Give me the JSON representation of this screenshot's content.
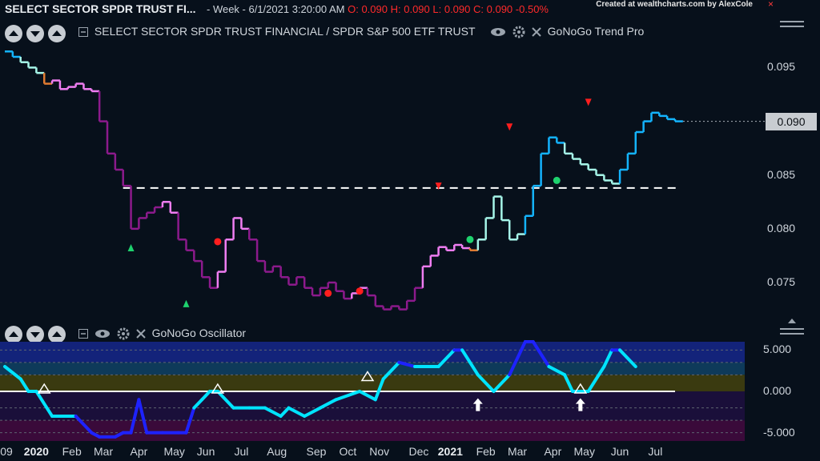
{
  "header": {
    "title": "SELECT SECTOR SPDR TRUST FI...",
    "meta_prefix": "- Week - 6/1/2021 3:20:00 AM",
    "open": "O: 0.090",
    "high": "H: 0.090",
    "low": "L: 0.090",
    "close": "C: 0.090",
    "change": "-0.50%",
    "credit": "Created at wealthcharts.com by AlexCole",
    "credit_x": "×"
  },
  "price_panel": {
    "legend": "SELECT SECTOR SPDR TRUST FINANCIAL / SPDR S&P 500 ETF TRUST",
    "indicator": "GoNoGo Trend Pro",
    "current_label": "0.090"
  },
  "osc_panel": {
    "indicator": "GoNoGo Oscillator"
  },
  "icons": {
    "up": "chevron-up-icon",
    "down": "chevron-down-icon",
    "eye": "eye-icon",
    "gear": "gear-icon",
    "close": "close-icon",
    "collapse": "minus-box-icon"
  },
  "colors": {
    "background": "#07101b",
    "go_strong": "#14b4ff",
    "go_weak": "#a6f6e9",
    "nogo_strong": "#8c1a8c",
    "nogo_weak": "#f07ef2",
    "amber": "#e07b31",
    "osc_high": "#00e4ff",
    "osc_low": "#1e22ff",
    "signal_red": "#ff1e1e",
    "signal_green": "#1ed26e"
  },
  "chart_data": [
    {
      "type": "line",
      "title": "SELECT SECTOR SPDR TRUST FINANCIAL / SPDR S&P 500 ETF TRUST",
      "ylim": [
        0.0715,
        0.0995
      ],
      "yticks": [
        0.075,
        0.08,
        0.085,
        0.09,
        0.095
      ],
      "ytick_labels": [
        "0.075",
        "0.080",
        "0.085",
        "0.090",
        "0.095"
      ],
      "support_level": 0.0838,
      "current_value": 0.09,
      "series": [
        {
          "values": [
            [
              0,
              0.0965,
              "go_strong"
            ],
            [
              1,
              0.096,
              "go_strong"
            ],
            [
              2,
              0.0955,
              "go_weak"
            ],
            [
              3,
              0.095,
              "go_weak"
            ],
            [
              4,
              0.0945,
              "go_weak"
            ],
            [
              5,
              0.0935,
              "amber"
            ],
            [
              6,
              0.0938,
              "nogo_weak"
            ],
            [
              7,
              0.093,
              "nogo_weak"
            ],
            [
              8,
              0.0932,
              "nogo_weak"
            ],
            [
              9,
              0.0935,
              "nogo_weak"
            ],
            [
              10,
              0.093,
              "nogo_weak"
            ],
            [
              11,
              0.0928,
              "nogo_weak"
            ],
            [
              12,
              0.09,
              "nogo_strong"
            ],
            [
              13,
              0.087,
              "nogo_strong"
            ],
            [
              14,
              0.0855,
              "nogo_strong"
            ],
            [
              15,
              0.084,
              "nogo_strong"
            ],
            [
              16,
              0.08,
              "nogo_strong"
            ],
            [
              17,
              0.081,
              "nogo_strong"
            ],
            [
              18,
              0.0815,
              "nogo_strong"
            ],
            [
              19,
              0.082,
              "nogo_strong"
            ],
            [
              20,
              0.0825,
              "nogo_weak"
            ],
            [
              21,
              0.0815,
              "nogo_weak"
            ],
            [
              22,
              0.079,
              "nogo_strong"
            ],
            [
              23,
              0.078,
              "nogo_strong"
            ],
            [
              24,
              0.077,
              "nogo_strong"
            ],
            [
              25,
              0.0755,
              "nogo_strong"
            ],
            [
              26,
              0.0745,
              "nogo_strong"
            ],
            [
              27,
              0.076,
              "nogo_weak"
            ],
            [
              28,
              0.079,
              "nogo_weak"
            ],
            [
              29,
              0.081,
              "nogo_weak"
            ],
            [
              30,
              0.08,
              "nogo_weak"
            ],
            [
              31,
              0.079,
              "nogo_strong"
            ],
            [
              32,
              0.077,
              "nogo_strong"
            ],
            [
              33,
              0.076,
              "nogo_strong"
            ],
            [
              34,
              0.0765,
              "nogo_strong"
            ],
            [
              35,
              0.0755,
              "nogo_strong"
            ],
            [
              36,
              0.0748,
              "nogo_strong"
            ],
            [
              37,
              0.0755,
              "nogo_strong"
            ],
            [
              38,
              0.0745,
              "nogo_strong"
            ],
            [
              39,
              0.0738,
              "nogo_strong"
            ],
            [
              40,
              0.0745,
              "nogo_strong"
            ],
            [
              41,
              0.075,
              "nogo_strong"
            ],
            [
              42,
              0.0742,
              "nogo_strong"
            ],
            [
              43,
              0.0735,
              "nogo_strong"
            ],
            [
              44,
              0.074,
              "nogo_weak"
            ],
            [
              45,
              0.0745,
              "nogo_weak"
            ],
            [
              46,
              0.0738,
              "nogo_strong"
            ],
            [
              47,
              0.0728,
              "nogo_strong"
            ],
            [
              48,
              0.0725,
              "nogo_strong"
            ],
            [
              49,
              0.0728,
              "nogo_strong"
            ],
            [
              50,
              0.0725,
              "nogo_strong"
            ],
            [
              51,
              0.0733,
              "nogo_strong"
            ],
            [
              52,
              0.0745,
              "nogo_strong"
            ],
            [
              53,
              0.0765,
              "nogo_weak"
            ],
            [
              54,
              0.0775,
              "nogo_weak"
            ],
            [
              55,
              0.0783,
              "nogo_weak"
            ],
            [
              56,
              0.078,
              "nogo_weak"
            ],
            [
              57,
              0.0785,
              "nogo_weak"
            ],
            [
              58,
              0.0782,
              "nogo_weak"
            ],
            [
              59,
              0.078,
              "amber"
            ],
            [
              60,
              0.079,
              "go_weak"
            ],
            [
              61,
              0.081,
              "go_weak"
            ],
            [
              62,
              0.083,
              "go_weak"
            ],
            [
              63,
              0.0808,
              "go_weak"
            ],
            [
              64,
              0.079,
              "go_weak"
            ],
            [
              65,
              0.0795,
              "go_weak"
            ],
            [
              66,
              0.0812,
              "go_strong"
            ],
            [
              67,
              0.084,
              "go_strong"
            ],
            [
              68,
              0.087,
              "go_strong"
            ],
            [
              69,
              0.0885,
              "go_strong"
            ],
            [
              70,
              0.088,
              "go_strong"
            ],
            [
              71,
              0.087,
              "go_weak"
            ],
            [
              72,
              0.0865,
              "go_weak"
            ],
            [
              73,
              0.086,
              "go_weak"
            ],
            [
              74,
              0.0855,
              "go_weak"
            ],
            [
              75,
              0.085,
              "go_weak"
            ],
            [
              76,
              0.0845,
              "go_weak"
            ],
            [
              77,
              0.0842,
              "go_weak"
            ],
            [
              78,
              0.0855,
              "go_strong"
            ],
            [
              79,
              0.087,
              "go_strong"
            ],
            [
              80,
              0.089,
              "go_strong"
            ],
            [
              81,
              0.09,
              "go_strong"
            ],
            [
              82,
              0.0908,
              "go_strong"
            ],
            [
              83,
              0.0905,
              "go_strong"
            ],
            [
              84,
              0.0902,
              "go_strong"
            ],
            [
              85,
              0.09,
              "go_strong"
            ]
          ]
        }
      ],
      "markers": [
        {
          "type": "up_triangle",
          "color": "signal_green",
          "x": 16,
          "y": 0.0782
        },
        {
          "type": "up_triangle",
          "color": "signal_green",
          "x": 23,
          "y": 0.073
        },
        {
          "type": "dot",
          "color": "signal_red",
          "x": 27,
          "y": 0.0788
        },
        {
          "type": "dot",
          "color": "signal_red",
          "x": 41,
          "y": 0.074
        },
        {
          "type": "dot",
          "color": "signal_red",
          "x": 45,
          "y": 0.0742
        },
        {
          "type": "down_triangle",
          "color": "signal_red",
          "x": 55,
          "y": 0.084
        },
        {
          "type": "dot",
          "color": "signal_green",
          "x": 59,
          "y": 0.079
        },
        {
          "type": "down_triangle",
          "color": "signal_red",
          "x": 64,
          "y": 0.0895
        },
        {
          "type": "dot",
          "color": "signal_green",
          "x": 70,
          "y": 0.0845
        },
        {
          "type": "down_triangle",
          "color": "signal_red",
          "x": 74,
          "y": 0.0918
        }
      ]
    },
    {
      "type": "line",
      "title": "GoNoGo Oscillator",
      "ylim": [
        -6,
        6
      ],
      "yticks": [
        -5,
        0,
        5
      ],
      "ytick_labels": [
        "-5.000",
        "0.000",
        "5.000"
      ],
      "x_extent": [
        0,
        85
      ],
      "series": [
        {
          "values": [
            [
              0,
              3
            ],
            [
              2,
              1.5
            ],
            [
              3,
              0
            ],
            [
              4,
              0
            ],
            [
              6,
              -3
            ],
            [
              9,
              -3
            ],
            [
              11,
              -5
            ],
            [
              12,
              -5.5
            ],
            [
              14,
              -5.5
            ],
            [
              15,
              -5
            ],
            [
              16,
              -5
            ],
            [
              17,
              -1
            ],
            [
              18,
              -5
            ],
            [
              20,
              -5
            ],
            [
              22,
              -5
            ],
            [
              23,
              -5
            ],
            [
              24,
              -2
            ],
            [
              25,
              -1
            ],
            [
              26,
              0
            ],
            [
              27,
              0
            ],
            [
              29,
              -2
            ],
            [
              31,
              -2
            ],
            [
              33,
              -2
            ],
            [
              35,
              -3
            ],
            [
              36,
              -2
            ],
            [
              38,
              -3
            ],
            [
              40,
              -2
            ],
            [
              42,
              -1
            ],
            [
              45,
              0
            ],
            [
              47,
              -1
            ],
            [
              48,
              1.5
            ],
            [
              50,
              3.5
            ],
            [
              52,
              3
            ],
            [
              55,
              3
            ],
            [
              57,
              5
            ],
            [
              58,
              5
            ],
            [
              60,
              2
            ],
            [
              62,
              0
            ],
            [
              64,
              2
            ],
            [
              66,
              6
            ],
            [
              67,
              6
            ],
            [
              69,
              3
            ],
            [
              71,
              2
            ],
            [
              72,
              0
            ],
            [
              74,
              0
            ],
            [
              76,
              3
            ],
            [
              77,
              5
            ],
            [
              78,
              5
            ],
            [
              80,
              3
            ]
          ]
        }
      ],
      "markers": [
        {
          "type": "open_triangle",
          "x": 5,
          "y": 0
        },
        {
          "type": "open_triangle",
          "x": 27,
          "y": 0
        },
        {
          "type": "open_triangle",
          "x": 46,
          "y": 1.5
        },
        {
          "type": "up_arrow",
          "x": 60,
          "y": -1.7
        },
        {
          "type": "up_arrow",
          "x": 73,
          "y": -1.7
        },
        {
          "type": "open_triangle",
          "x": 73,
          "y": 0
        }
      ]
    }
  ],
  "x_axis": {
    "x_extent": [
      0,
      85
    ],
    "ticks": [
      {
        "x": -1,
        "label": "09",
        "bold": false
      },
      {
        "x": 4,
        "label": "2020",
        "bold": true
      },
      {
        "x": 8.5,
        "label": "Feb",
        "bold": false
      },
      {
        "x": 12.5,
        "label": "Mar",
        "bold": false
      },
      {
        "x": 17,
        "label": "Apr",
        "bold": false
      },
      {
        "x": 21.5,
        "label": "May",
        "bold": false
      },
      {
        "x": 25.5,
        "label": "Jun",
        "bold": false
      },
      {
        "x": 30,
        "label": "Jul",
        "bold": false
      },
      {
        "x": 34.5,
        "label": "Aug",
        "bold": false
      },
      {
        "x": 39.5,
        "label": "Sep",
        "bold": false
      },
      {
        "x": 43.5,
        "label": "Oct",
        "bold": false
      },
      {
        "x": 47.5,
        "label": "Nov",
        "bold": false
      },
      {
        "x": 52.5,
        "label": "Dec",
        "bold": false
      },
      {
        "x": 56.5,
        "label": "2021",
        "bold": true
      },
      {
        "x": 61,
        "label": "Feb",
        "bold": false
      },
      {
        "x": 65,
        "label": "Mar",
        "bold": false
      },
      {
        "x": 69.5,
        "label": "Apr",
        "bold": false
      },
      {
        "x": 73.5,
        "label": "May",
        "bold": false
      },
      {
        "x": 78,
        "label": "Jun",
        "bold": false
      },
      {
        "x": 82.5,
        "label": "Jul",
        "bold": false
      }
    ]
  }
}
